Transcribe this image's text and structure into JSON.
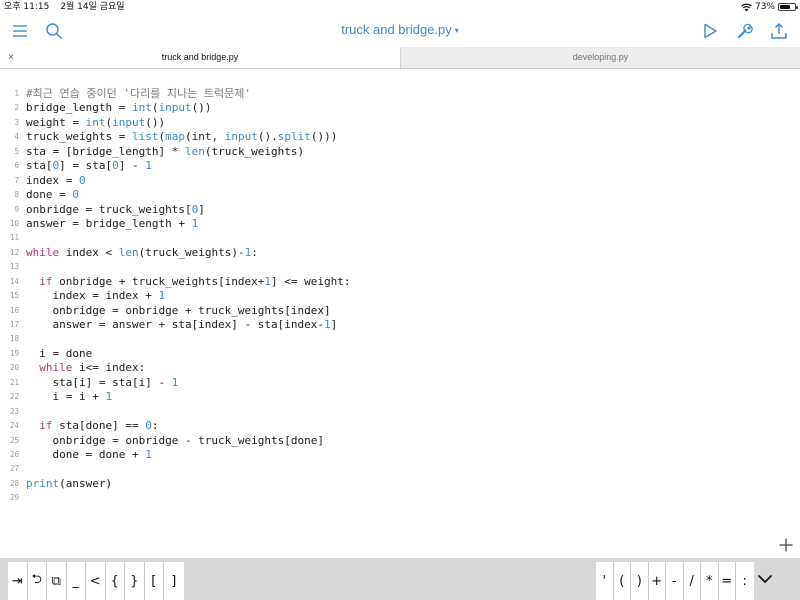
{
  "status_bar": {
    "time": "오후 11:15",
    "date": "2월 14일 금요일",
    "battery": "73%",
    "battery_level": 0.73
  },
  "toolbar": {
    "title": "truck and bridge.py",
    "title_caret": "▾",
    "icons": [
      "menu-icon",
      "search-icon",
      "run-icon",
      "wrench-icon",
      "share-icon"
    ]
  },
  "tabs": [
    {
      "label": "truck and bridge.py",
      "active": true
    },
    {
      "label": "developing.py",
      "active": false
    }
  ],
  "tab_close": "×",
  "editor": {
    "lines": [
      {
        "n": "1",
        "tokens": [
          [
            "cm",
            "#최근 연습 중이던 '다리를 지나는 트럭문제'"
          ]
        ]
      },
      {
        "n": "2",
        "tokens": [
          [
            "",
            "bridge_length = "
          ],
          [
            "fn",
            "int"
          ],
          [
            "",
            "("
          ],
          [
            "fn",
            "input"
          ],
          [
            "",
            "())"
          ]
        ]
      },
      {
        "n": "3",
        "tokens": [
          [
            "",
            "weight = "
          ],
          [
            "fn",
            "int"
          ],
          [
            "",
            "("
          ],
          [
            "fn",
            "input"
          ],
          [
            "",
            "())"
          ]
        ]
      },
      {
        "n": "4",
        "tokens": [
          [
            "",
            "truck_weights = "
          ],
          [
            "fn",
            "list"
          ],
          [
            "",
            "("
          ],
          [
            "fn",
            "map"
          ],
          [
            "",
            "(int, "
          ],
          [
            "fn",
            "input"
          ],
          [
            "",
            "()."
          ],
          [
            "fn",
            "split"
          ],
          [
            "",
            "()))"
          ]
        ]
      },
      {
        "n": "5",
        "tokens": [
          [
            "",
            "sta = [bridge_length] * "
          ],
          [
            "fn",
            "len"
          ],
          [
            "",
            "(truck_weights)"
          ]
        ]
      },
      {
        "n": "6",
        "tokens": [
          [
            "",
            "sta["
          ],
          [
            "num",
            "0"
          ],
          [
            "",
            "] = sta["
          ],
          [
            "num",
            "0"
          ],
          [
            "",
            "] - "
          ],
          [
            "num",
            "1"
          ]
        ]
      },
      {
        "n": "7",
        "tokens": [
          [
            "",
            "index = "
          ],
          [
            "num",
            "0"
          ]
        ]
      },
      {
        "n": "8",
        "tokens": [
          [
            "",
            "done = "
          ],
          [
            "num",
            "0"
          ]
        ]
      },
      {
        "n": "9",
        "tokens": [
          [
            "",
            "onbridge = truck_weights["
          ],
          [
            "num",
            "0"
          ],
          [
            "",
            "]"
          ]
        ]
      },
      {
        "n": "10",
        "tokens": [
          [
            "",
            "answer = bridge_length + "
          ],
          [
            "num",
            "1"
          ]
        ]
      },
      {
        "n": "11",
        "tokens": []
      },
      {
        "n": "12",
        "tokens": [
          [
            "kw",
            "while"
          ],
          [
            "",
            " index < "
          ],
          [
            "fn",
            "len"
          ],
          [
            "",
            "(truck_weights)-"
          ],
          [
            "num",
            "1"
          ],
          [
            "",
            ":"
          ]
        ]
      },
      {
        "n": "13",
        "tokens": []
      },
      {
        "n": "14",
        "tokens": [
          [
            "",
            "  "
          ],
          [
            "kw",
            "if"
          ],
          [
            "",
            " onbridge + truck_weights[index+"
          ],
          [
            "num",
            "1"
          ],
          [
            "",
            "] <= weight:"
          ]
        ]
      },
      {
        "n": "15",
        "tokens": [
          [
            "",
            "    index = index + "
          ],
          [
            "num",
            "1"
          ]
        ]
      },
      {
        "n": "16",
        "tokens": [
          [
            "",
            "    onbridge = onbridge + truck_weights[index]"
          ]
        ]
      },
      {
        "n": "17",
        "tokens": [
          [
            "",
            "    answer = answer + sta[index] - sta[index-"
          ],
          [
            "num",
            "1"
          ],
          [
            "",
            "]"
          ]
        ]
      },
      {
        "n": "18",
        "tokens": []
      },
      {
        "n": "19",
        "tokens": [
          [
            "",
            "  i = done"
          ]
        ]
      },
      {
        "n": "20",
        "tokens": [
          [
            "",
            "  "
          ],
          [
            "kw",
            "while"
          ],
          [
            "",
            " i<= index:"
          ]
        ]
      },
      {
        "n": "21",
        "tokens": [
          [
            "",
            "    sta[i] = sta[i] - "
          ],
          [
            "num",
            "1"
          ]
        ]
      },
      {
        "n": "22",
        "tokens": [
          [
            "",
            "    i = i + "
          ],
          [
            "num",
            "1"
          ]
        ]
      },
      {
        "n": "23",
        "tokens": []
      },
      {
        "n": "24",
        "tokens": [
          [
            "",
            "  "
          ],
          [
            "kw",
            "if"
          ],
          [
            "",
            " sta[done] == "
          ],
          [
            "num",
            "0"
          ],
          [
            "",
            ":"
          ]
        ]
      },
      {
        "n": "25",
        "tokens": [
          [
            "",
            "    onbridge = onbridge - truck_weights[done]"
          ]
        ]
      },
      {
        "n": "26",
        "tokens": [
          [
            "",
            "    done = done + "
          ],
          [
            "num",
            "1"
          ]
        ]
      },
      {
        "n": "27",
        "tokens": []
      },
      {
        "n": "28",
        "tokens": [
          [
            "fn",
            "print"
          ],
          [
            "",
            "(answer)"
          ]
        ]
      },
      {
        "n": "29",
        "tokens": []
      }
    ]
  },
  "key_bar": {
    "left_keys": [
      "⇥",
      "⮌",
      "⧉",
      "_",
      "<",
      "{",
      "}",
      "[",
      "]"
    ],
    "right_keys": [
      "'",
      "(",
      ")",
      "+",
      "-",
      "/",
      "*",
      "=",
      ":"
    ]
  },
  "colors": {
    "accent": "#3b8bd0",
    "keyword": "#b5357a",
    "builtin": "#3a8cc9",
    "comment": "#7b7b7b"
  }
}
